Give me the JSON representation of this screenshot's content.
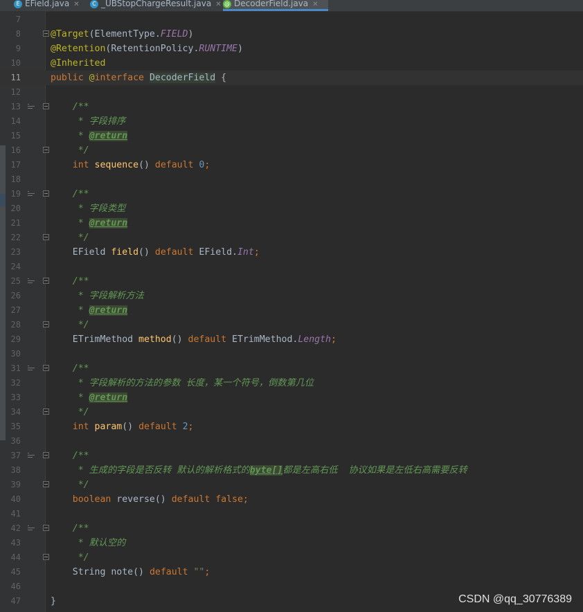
{
  "tabs": [
    {
      "label": "EField.java",
      "icon": "E",
      "icon_color": "#3592c4",
      "active": false
    },
    {
      "label": "_UBStopChargeResult.java",
      "icon": "C",
      "icon_color": "#3592c4",
      "active": false
    },
    {
      "label": "DecoderField.java",
      "icon": "@",
      "icon_color": "#62b543",
      "active": true
    }
  ],
  "current_line": "11",
  "lines": [
    {
      "n": "7",
      "t": []
    },
    {
      "n": "8",
      "t": [
        [
          "ann",
          "@Target"
        ],
        [
          "plain",
          "(ElementType."
        ],
        [
          "it",
          "FIELD"
        ],
        [
          "plain",
          ")"
        ]
      ]
    },
    {
      "n": "9",
      "t": [
        [
          "ann",
          "@Retention"
        ],
        [
          "plain",
          "(RetentionPolicy."
        ],
        [
          "it",
          "RUNTIME"
        ],
        [
          "plain",
          ")"
        ]
      ]
    },
    {
      "n": "10",
      "t": [
        [
          "ann",
          "@Inherited"
        ]
      ]
    },
    {
      "n": "11",
      "t": [
        [
          "kw",
          "public "
        ],
        [
          "ann",
          "@"
        ],
        [
          "kw",
          "interface "
        ],
        [
          "hl",
          "DecoderField"
        ],
        [
          "plain",
          " {"
        ]
      ]
    },
    {
      "n": "12",
      "t": []
    },
    {
      "n": "13",
      "t": [
        [
          "doc",
          "    /**"
        ]
      ]
    },
    {
      "n": "14",
      "t": [
        [
          "doc",
          "     * 字段排序"
        ]
      ]
    },
    {
      "n": "15",
      "t": [
        [
          "doc",
          "     * "
        ],
        [
          "dtag",
          "@return"
        ]
      ]
    },
    {
      "n": "16",
      "t": [
        [
          "doc",
          "     */"
        ]
      ]
    },
    {
      "n": "17",
      "t": [
        [
          "kw",
          "    int "
        ],
        [
          "fn",
          "sequence"
        ],
        [
          "plain",
          "() "
        ],
        [
          "kw",
          "default "
        ],
        [
          "num",
          "0"
        ],
        [
          "kw",
          ";"
        ]
      ]
    },
    {
      "n": "18",
      "t": []
    },
    {
      "n": "19",
      "t": [
        [
          "doc",
          "    /**"
        ]
      ]
    },
    {
      "n": "20",
      "t": [
        [
          "doc",
          "     * 字段类型"
        ]
      ]
    },
    {
      "n": "21",
      "t": [
        [
          "doc",
          "     * "
        ],
        [
          "dtag",
          "@return"
        ]
      ]
    },
    {
      "n": "22",
      "t": [
        [
          "doc",
          "     */"
        ]
      ]
    },
    {
      "n": "23",
      "t": [
        [
          "plain",
          "    EField "
        ],
        [
          "fn",
          "field"
        ],
        [
          "plain",
          "() "
        ],
        [
          "kw",
          "default "
        ],
        [
          "plain",
          "EField."
        ],
        [
          "it",
          "Int"
        ],
        [
          "kw",
          ";"
        ]
      ]
    },
    {
      "n": "24",
      "t": []
    },
    {
      "n": "25",
      "t": [
        [
          "doc",
          "    /**"
        ]
      ]
    },
    {
      "n": "26",
      "t": [
        [
          "doc",
          "     * 字段解析方法"
        ]
      ]
    },
    {
      "n": "27",
      "t": [
        [
          "doc",
          "     * "
        ],
        [
          "dtag",
          "@return"
        ]
      ]
    },
    {
      "n": "28",
      "t": [
        [
          "doc",
          "     */"
        ]
      ]
    },
    {
      "n": "29",
      "t": [
        [
          "plain",
          "    ETrimMethod "
        ],
        [
          "fn",
          "method"
        ],
        [
          "plain",
          "() "
        ],
        [
          "kw",
          "default "
        ],
        [
          "plain",
          "ETrimMethod."
        ],
        [
          "it",
          "Length"
        ],
        [
          "kw",
          ";"
        ]
      ]
    },
    {
      "n": "30",
      "t": []
    },
    {
      "n": "31",
      "t": [
        [
          "doc",
          "    /**"
        ]
      ]
    },
    {
      "n": "32",
      "t": [
        [
          "doc",
          "     * 字段解析的方法的参数 长度，某一个符号，倒数第几位"
        ]
      ]
    },
    {
      "n": "33",
      "t": [
        [
          "doc",
          "     * "
        ],
        [
          "dtag",
          "@return"
        ]
      ]
    },
    {
      "n": "34",
      "t": [
        [
          "doc",
          "     */"
        ]
      ]
    },
    {
      "n": "35",
      "t": [
        [
          "kw",
          "    int "
        ],
        [
          "fn",
          "param"
        ],
        [
          "plain",
          "() "
        ],
        [
          "kw",
          "default "
        ],
        [
          "num",
          "2"
        ],
        [
          "kw",
          ";"
        ]
      ]
    },
    {
      "n": "36",
      "t": []
    },
    {
      "n": "37",
      "t": [
        [
          "doc",
          "    /**"
        ]
      ]
    },
    {
      "n": "38",
      "t": [
        [
          "doc",
          "     * 生成的字段是否反转 默认的解析格式的"
        ],
        [
          "dtag",
          "byte[]"
        ],
        [
          "doc",
          "都是左高右低  协议如果是左低右高需要反转"
        ]
      ]
    },
    {
      "n": "39",
      "t": [
        [
          "doc",
          "     */"
        ]
      ]
    },
    {
      "n": "40",
      "t": [
        [
          "kw",
          "    boolean "
        ],
        [
          "gray",
          "reverse"
        ],
        [
          "plain",
          "() "
        ],
        [
          "kw",
          "default false"
        ],
        [
          "kw",
          ";"
        ]
      ]
    },
    {
      "n": "41",
      "t": []
    },
    {
      "n": "42",
      "t": [
        [
          "doc",
          "    /**"
        ]
      ]
    },
    {
      "n": "43",
      "t": [
        [
          "doc",
          "     * 默认空的"
        ]
      ]
    },
    {
      "n": "44",
      "t": [
        [
          "doc",
          "     */"
        ]
      ]
    },
    {
      "n": "45",
      "t": [
        [
          "plain",
          "    String "
        ],
        [
          "gray",
          "note"
        ],
        [
          "plain",
          "() "
        ],
        [
          "kw",
          "default "
        ],
        [
          "str",
          "\"\""
        ],
        [
          "kw",
          ";"
        ]
      ]
    },
    {
      "n": "46",
      "t": []
    },
    {
      "n": "47",
      "t": [
        [
          "plain",
          "}"
        ]
      ]
    }
  ],
  "bookmark_lines": [
    "13",
    "19",
    "25",
    "31",
    "37",
    "42"
  ],
  "fold_lines": [
    "8",
    "13",
    "16",
    "19",
    "22",
    "25",
    "28",
    "31",
    "34",
    "37",
    "39",
    "42",
    "44"
  ],
  "watermark": "CSDN @qq_30776389"
}
